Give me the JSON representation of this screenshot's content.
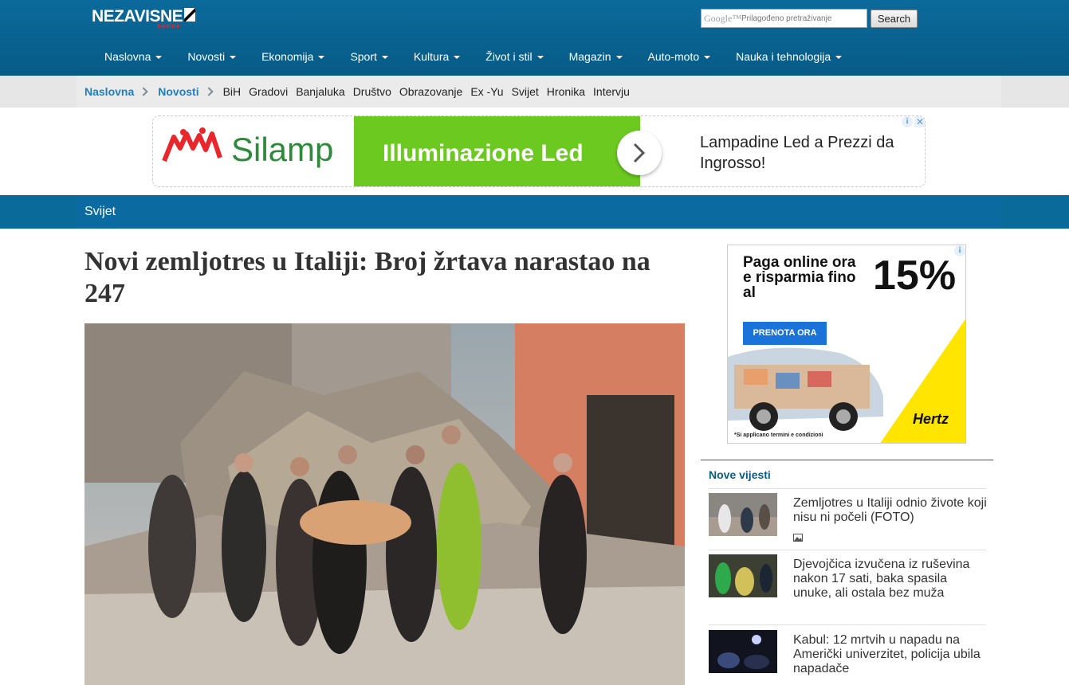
{
  "header": {
    "logo_text": "NEZAVISNE",
    "logo_sub": "novine",
    "search": {
      "brand": "Google™",
      "placeholder": "Prilagođeno pretraživanje",
      "button": "Search"
    },
    "nav": [
      "Naslovna",
      "Novosti",
      "Ekonomija",
      "Sport",
      "Kultura",
      "Život i stil",
      "Magazin",
      "Auto-moto",
      "Nauka i tehnologija"
    ]
  },
  "breadcrumb": [
    "Naslovna",
    "Novosti"
  ],
  "subcategories": [
    "BiH",
    "Gradovi",
    "Banjaluka",
    "Društvo",
    "Obrazovanje",
    "Ex -Yu",
    "Svijet",
    "Hronika",
    "Intervju"
  ],
  "banner_ad": {
    "brand": "Silamp",
    "green_text": "Illuminazione Led",
    "copy": "Lampadine Led a Prezzi da Ingrosso!",
    "info": "i",
    "close": "✕",
    "colors": {
      "green": "#6bc920",
      "brand": "#2d8a3a",
      "logo_red": "#e8262b"
    }
  },
  "section": {
    "title": "Svijet"
  },
  "article": {
    "headline": "Novi zemljotres u Italiji: Broj žrtava narastao na 247"
  },
  "side_ad": {
    "text": "Paga online ora e risparmia fino al",
    "percent": "15%",
    "button": "PRENOTA ORA",
    "brand": "Hertz",
    "fine_print": "*Si applicano termini e condizioni",
    "info": "i",
    "colors": {
      "button": "#1a73d9",
      "accent": "#ffe500"
    }
  },
  "news": {
    "heading": "Nove vijesti",
    "items": [
      {
        "title": "Zemljotres u Italiji odnio živote koji nisu ni počeli (FOTO)",
        "icon": "photo-icon"
      },
      {
        "title": "Djevojčica izvučena iz ruševina nakon 17 sati, baka spasila unuke, ali ostala bez muža"
      },
      {
        "title": "Kabul: 12 mrtvih u napadu na Američki univerzitet, policija ubila napadače"
      }
    ]
  },
  "colors": {
    "header": "#0b6a9b",
    "link": "#1e7fc0"
  }
}
